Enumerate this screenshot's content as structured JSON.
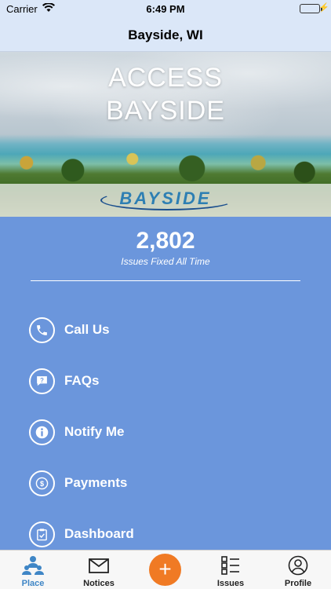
{
  "status_bar": {
    "carrier": "Carrier",
    "time": "6:49 PM"
  },
  "nav": {
    "title": "Bayside, WI"
  },
  "hero": {
    "title_line1": "ACCESS",
    "title_line2": "BAYSIDE",
    "logo_text": "BAYSIDE"
  },
  "stats": {
    "count": "2,802",
    "label": "Issues Fixed All Time"
  },
  "menu": {
    "items": [
      {
        "label": "Call Us",
        "icon": "phone-icon"
      },
      {
        "label": "FAQs",
        "icon": "faq-chat-icon"
      },
      {
        "label": "Notify Me",
        "icon": "info-icon"
      },
      {
        "label": "Payments",
        "icon": "dollar-icon"
      },
      {
        "label": "Dashboard",
        "icon": "clipboard-icon"
      }
    ]
  },
  "tabs": [
    {
      "label": "Place",
      "icon": "people-icon",
      "active": true
    },
    {
      "label": "Notices",
      "icon": "mail-icon",
      "active": false
    },
    {
      "label": "Issues",
      "icon": "list-icon",
      "active": false
    },
    {
      "label": "Profile",
      "icon": "user-icon",
      "active": false
    }
  ],
  "fab": {
    "label": "+"
  },
  "colors": {
    "accent_blue": "#3f86c6",
    "fab_orange": "#f07a24",
    "background": "#6b96dc"
  }
}
